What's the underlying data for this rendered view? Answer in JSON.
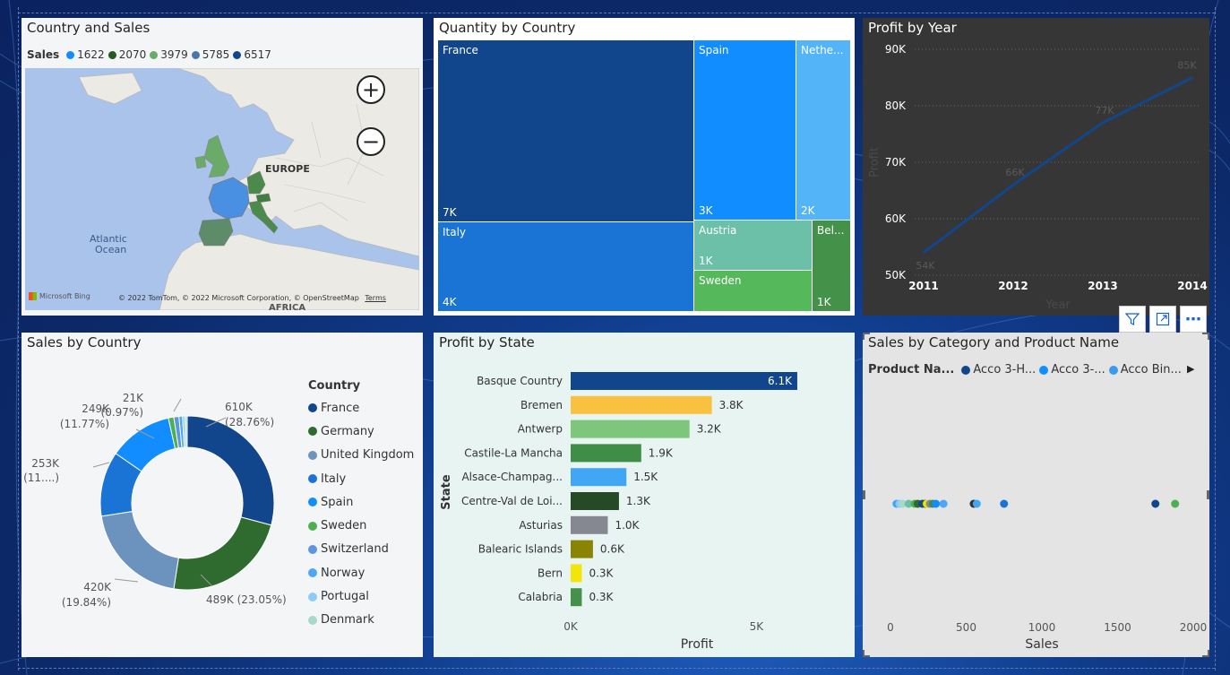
{
  "panels": {
    "map": {
      "title": "Country and Sales",
      "legend_title": "Sales",
      "legend": [
        {
          "label": "1622",
          "color": "#118DFF"
        },
        {
          "label": "2070",
          "color": "#235B20"
        },
        {
          "label": "3979",
          "color": "#6AAB6A"
        },
        {
          "label": "5785",
          "color": "#4B76A8"
        },
        {
          "label": "6517",
          "color": "#12468C"
        }
      ],
      "label_europe": "EUROPE",
      "label_atlantic_1": "Atlantic",
      "label_atlantic_2": "Ocean",
      "label_africa": "AFRICA",
      "bing": "Microsoft Bing",
      "copyright": "© 2022 TomTom, © 2022 Microsoft Corporation, © OpenStreetMap",
      "terms": "Terms"
    },
    "treemap": {
      "title": "Quantity by Country",
      "tiles": [
        {
          "name": "France",
          "value": "7K",
          "color": "#12468C"
        },
        {
          "name": "Spain",
          "value": "3K",
          "color": "#118DFF"
        },
        {
          "name": "Nethe...",
          "value": "2K",
          "color": "#54B4F8"
        },
        {
          "name": "Italy",
          "value": "4K",
          "color": "#1A74D6"
        },
        {
          "name": "Austria",
          "value": "1K",
          "color": "#6DC0A8"
        },
        {
          "name": "Bel...",
          "value": "1K",
          "color": "#44924A"
        },
        {
          "name": "Sweden",
          "value": "",
          "color": "#55B95C"
        }
      ]
    },
    "line": {
      "title": "Profit by Year",
      "xlabel": "Year",
      "ylabel": "Profit"
    },
    "donut": {
      "title": "Sales by Country",
      "legend_title": "Country",
      "legend": [
        {
          "label": "France",
          "color": "#12468C"
        },
        {
          "label": "Germany",
          "color": "#2F6A2F"
        },
        {
          "label": "United Kingdom",
          "color": "#6B93BD"
        },
        {
          "label": "Italy",
          "color": "#1A74D6"
        },
        {
          "label": "Spain",
          "color": "#118DFF"
        },
        {
          "label": "Sweden",
          "color": "#4CAF50"
        },
        {
          "label": "Switzerland",
          "color": "#5E95E0"
        },
        {
          "label": "Norway",
          "color": "#4FA6F2"
        },
        {
          "label": "Portugal",
          "color": "#8DCCF8"
        },
        {
          "label": "Denmark",
          "color": "#A6D9C8"
        }
      ],
      "labels": {
        "france_1": "610K",
        "france_2": "(28.76%)",
        "germany": "489K (23.05%)",
        "uk_1": "420K",
        "uk_2": "(19.84%)",
        "italy_1": "253K",
        "italy_2": "(11....)",
        "spain_1": "249K",
        "spain_2": "(11.77%)",
        "small_1": "21K",
        "small_2": "(0.97%)"
      }
    },
    "bar": {
      "title": "Profit by State",
      "xlabel": "Profit",
      "ylabel": "State"
    },
    "scatter": {
      "title": "Sales by Category and Product Name",
      "legend_title": "Product Na...",
      "legend": [
        {
          "label": "Acco 3-H...",
          "color": "#12468C"
        },
        {
          "label": "Acco 3-...",
          "color": "#118DFF"
        },
        {
          "label": "Acco Bin...",
          "color": "#3A9BEB"
        }
      ],
      "xlabel": "Sales"
    }
  },
  "visual_header": {
    "filter_icon": "filter-icon",
    "focus_icon": "focus-mode-icon",
    "more_icon": "more-options-icon",
    "more_label": "⋯"
  },
  "chart_data": [
    {
      "type": "treemap",
      "title": "Quantity by Country",
      "categories": [
        "France",
        "Italy",
        "Spain",
        "Nethe...",
        "Austria",
        "Sweden",
        "Bel..."
      ],
      "values": [
        7000,
        4000,
        3000,
        2000,
        1000,
        1000,
        1000
      ]
    },
    {
      "type": "line",
      "title": "Profit by Year",
      "x": [
        "2011",
        "2012",
        "2013",
        "2014"
      ],
      "series": [
        {
          "values": [
            54000,
            66000,
            77000,
            85000
          ]
        }
      ],
      "data_labels": [
        "54K",
        "66K",
        "77K",
        "85K"
      ],
      "yticks": [
        "50K",
        "60K",
        "70K",
        "80K",
        "90K"
      ],
      "ylim": [
        50000,
        90000
      ],
      "xlabel": "Year",
      "ylabel": "Profit",
      "grid": true
    },
    {
      "type": "pie",
      "title": "Sales by Country",
      "categories": [
        "France",
        "Germany",
        "United Kingdom",
        "Italy",
        "Spain",
        "Sweden",
        "Switzerland",
        "Norway",
        "Portugal",
        "Denmark"
      ],
      "values": [
        610,
        489,
        420,
        253,
        249,
        21,
        20,
        14,
        10,
        8
      ],
      "unit": "K",
      "donut": true,
      "legend_position": "right"
    },
    {
      "type": "bar",
      "orientation": "horizontal",
      "title": "Profit by State",
      "categories": [
        "Basque Country",
        "Bremen",
        "Antwerp",
        "Castile-La Mancha",
        "Alsace-Champag...",
        "Centre-Val de Loi...",
        "Asturias",
        "Balearic Islands",
        "Bern",
        "Calabria"
      ],
      "values": [
        6100,
        3800,
        3200,
        1900,
        1500,
        1300,
        1000,
        600,
        300,
        300
      ],
      "data_labels": [
        "6.1K",
        "3.8K",
        "3.2K",
        "1.9K",
        "1.5K",
        "1.3K",
        "1.0K",
        "0.6K",
        "0.3K",
        "0.3K"
      ],
      "colors": [
        "#12468C",
        "#F9C140",
        "#7DC67B",
        "#3F8E47",
        "#41A7F5",
        "#244A26",
        "#858891",
        "#8A8404",
        "#F2E509",
        "#47904B"
      ],
      "xticks": [
        "0K",
        "5K"
      ],
      "xlim": [
        0,
        6800
      ],
      "xlabel": "Profit",
      "ylabel": "State"
    },
    {
      "type": "scatter",
      "title": "Sales by Category and Product Name",
      "series": [
        {
          "values": [
            [
              40,
              0
            ],
            [
              60,
              0
            ],
            [
              80,
              0
            ],
            [
              120,
              0
            ],
            [
              160,
              0
            ],
            [
              180,
              0
            ],
            [
              210,
              0
            ],
            [
              230,
              0
            ],
            [
              240,
              0
            ],
            [
              260,
              0
            ],
            [
              280,
              0
            ],
            [
              300,
              0
            ],
            [
              350,
              0
            ],
            [
              550,
              0
            ],
            [
              570,
              0
            ],
            [
              750,
              0
            ],
            [
              1750,
              0
            ],
            [
              1880,
              0
            ]
          ]
        }
      ],
      "point_colors": [
        "#41A7F5",
        "#8DCCF8",
        "#A6D9C8",
        "#6DC0A8",
        "#4CAF50",
        "#2F6A2F",
        "#12468C",
        "#235B20",
        "#F2E509",
        "#858891",
        "#3F8E47",
        "#118DFF",
        "#4FA6F2",
        "#333333",
        "#41A7F5",
        "#1A74D6",
        "#12468C",
        "#4CAF50"
      ],
      "xticks": [
        "0",
        "500",
        "1000",
        "1500",
        "2000"
      ],
      "xlim": [
        0,
        2000
      ],
      "xlabel": "Sales"
    }
  ]
}
